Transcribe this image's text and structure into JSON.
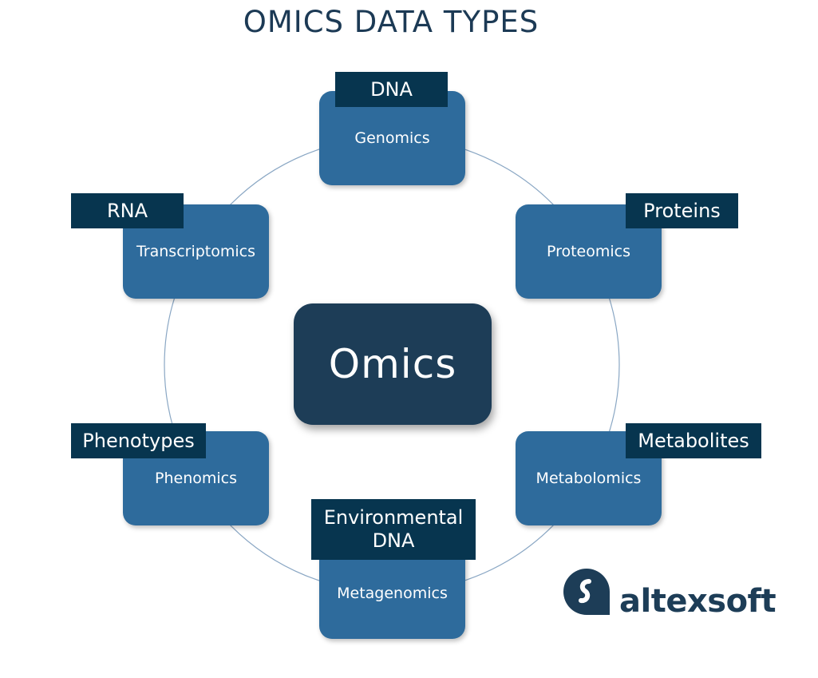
{
  "title": "OMICS DATA TYPES",
  "center": "Omics",
  "nodes": [
    {
      "field": "Genomics",
      "data_type": "DNA"
    },
    {
      "field": "Proteomics",
      "data_type": "Proteins"
    },
    {
      "field": "Metabolomics",
      "data_type": "Metabolites"
    },
    {
      "field": "Metagenomics",
      "data_type": "Environmental DNA"
    },
    {
      "field": "Phenomics",
      "data_type": "Phenotypes"
    },
    {
      "field": "Transcriptomics",
      "data_type": "RNA"
    }
  ],
  "logo": {
    "text": "altexsoft"
  },
  "colors": {
    "box": "#2e6b9c",
    "tag": "#07354f",
    "center": "#1d3d57",
    "title": "#1c3a55",
    "ring": "#8aa7c4"
  }
}
